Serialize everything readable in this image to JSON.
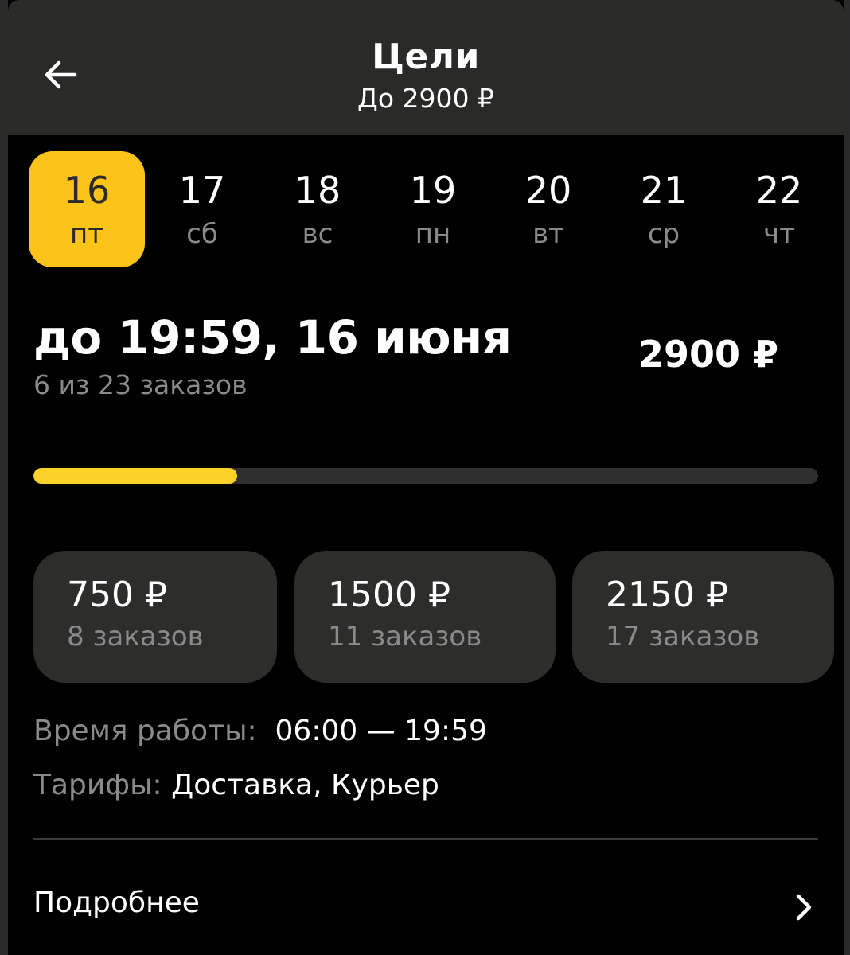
{
  "header": {
    "title": "Цели",
    "subtitle": "До 2900 ₽",
    "back_icon": "arrow-left-icon"
  },
  "days": [
    {
      "num": "16",
      "weekday": "пт",
      "selected": true
    },
    {
      "num": "17",
      "weekday": "сб",
      "selected": false
    },
    {
      "num": "18",
      "weekday": "вс",
      "selected": false
    },
    {
      "num": "19",
      "weekday": "пн",
      "selected": false
    },
    {
      "num": "20",
      "weekday": "вт",
      "selected": false
    },
    {
      "num": "21",
      "weekday": "ср",
      "selected": false
    },
    {
      "num": "22",
      "weekday": "чт",
      "selected": false
    }
  ],
  "goal": {
    "deadline": "до 19:59, 16 июня",
    "orders_progress": "6 из 23 заказов",
    "amount": "2900 ₽",
    "progress_fraction": 0.26
  },
  "tiers": [
    {
      "amount": "750 ₽",
      "orders": "8 заказов"
    },
    {
      "amount": "1500 ₽",
      "orders": "11 заказов"
    },
    {
      "amount": "2150 ₽",
      "orders": "17 заказов"
    }
  ],
  "info": {
    "hours_label": "Время работы:",
    "hours_value": "06:00 — 19:59",
    "tariffs_label": "Тарифы:",
    "tariffs_value": "Доставка, Курьер"
  },
  "more": {
    "label": "Подробнее",
    "icon": "chevron-right-icon"
  },
  "colors": {
    "accent": "#fcc419",
    "progress_fill": "#fcd12a",
    "background": "#000000",
    "header_bg": "#2a2a28",
    "card_bg": "#2d2d2c",
    "muted_text": "#8a8a8a"
  }
}
